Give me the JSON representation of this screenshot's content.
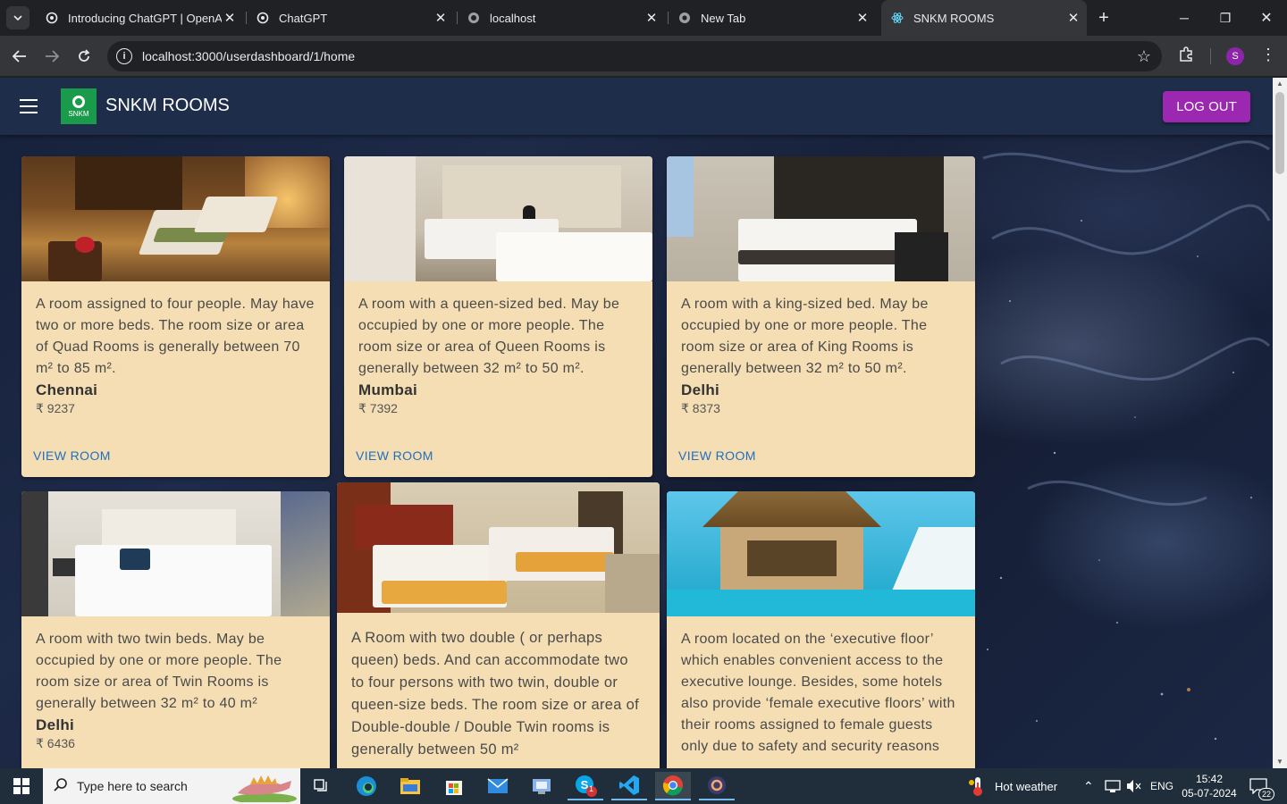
{
  "browser": {
    "tabs": [
      {
        "title": "Introducing ChatGPT | OpenAI",
        "icon": "openai-icon"
      },
      {
        "title": "ChatGPT",
        "icon": "openai-icon"
      },
      {
        "title": "localhost",
        "icon": "globe-icon"
      },
      {
        "title": "New Tab",
        "icon": "chrome-icon"
      },
      {
        "title": "SNKM ROOMS",
        "icon": "react-icon",
        "active": true
      }
    ],
    "url": "localhost:3000/userdashboard/1/home",
    "profile_initial": "S"
  },
  "app": {
    "brand": "SNKM ROOMS",
    "logo_text": "SNKM",
    "logout_label": "LOG OUT",
    "colors": {
      "appbar": "#1e2e4a",
      "logout": "#9c27b0",
      "card": "#f5deb3",
      "link": "#1e6fc2",
      "logo": "#1a9a4b"
    }
  },
  "rooms": [
    {
      "description": "A room assigned to four people. May have two or more beds. The room size or area of Quad Rooms is generally between 70 m² to 85 m².",
      "city": "Chennai",
      "price": "₹ 9237",
      "action": "VIEW ROOM"
    },
    {
      "description": "A room with a queen-sized bed. May be occupied by one or more people. The room size or area of Queen Rooms is generally between 32 m² to 50 m².",
      "city": "Mumbai",
      "price": "₹ 7392",
      "action": "VIEW ROOM"
    },
    {
      "description": "A room with a king-sized bed. May be occupied by one or more people. The room size or area of King Rooms is generally between 32 m² to 50 m².",
      "city": "Delhi",
      "price": "₹ 8373",
      "action": "VIEW ROOM"
    },
    {
      "description": "A room with two twin beds. May be occupied by one or more people. The room size or area of Twin Rooms is generally between 32 m² to 40 m²",
      "city": "Delhi",
      "price": "₹ 6436",
      "action": "VIEW ROOM"
    },
    {
      "description": "A Room with two double ( or perhaps queen) beds. And can accommodate two to four persons with two twin, double or queen-size beds. The room size or area of Double-double / Double Twin rooms is generally between 50 m²",
      "city": "",
      "price": "",
      "action": ""
    },
    {
      "description": "A room located on the ‘executive floor’ which enables convenient access to the executive lounge. Besides, some hotels also provide ‘female executive floors’ with their rooms assigned to female guests only due to safety and security reasons",
      "city": "",
      "price": "",
      "action": ""
    }
  ],
  "taskbar": {
    "search_placeholder": "Type here to search",
    "weather": "Hot weather",
    "language": "ENG",
    "time": "15:42",
    "date": "05-07-2024",
    "notifications": "22",
    "skype_badge": "1"
  }
}
